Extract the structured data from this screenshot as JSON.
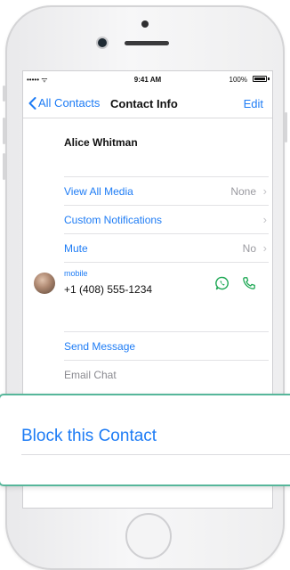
{
  "status_bar": {
    "signal": "••••• ᯤ",
    "time": "9:41 AM",
    "battery_percent": "100%"
  },
  "nav": {
    "back_label": "All Contacts",
    "title": "Contact Info",
    "edit_label": "Edit"
  },
  "contact": {
    "name": "Alice Whitman",
    "phone_label": "mobile",
    "phone_number": "+1 (408) 555-1234"
  },
  "rows": [
    {
      "label": "View All Media",
      "value": "None"
    },
    {
      "label": "Custom Notifications",
      "value": ""
    },
    {
      "label": "Mute",
      "value": "No"
    }
  ],
  "actions": {
    "send_message": "Send Message",
    "email_chat": "Email Chat",
    "block_contact": "Block this Contact"
  },
  "colors": {
    "accent": "#1e7cf5",
    "callout_border": "#56b69a",
    "whatsapp_icon": "#1fa855"
  },
  "icons": {
    "back": "chevron-left-icon",
    "chevron": "chevron-right-icon",
    "whatsapp": "whatsapp-icon",
    "call": "phone-icon",
    "battery": "battery-icon"
  }
}
